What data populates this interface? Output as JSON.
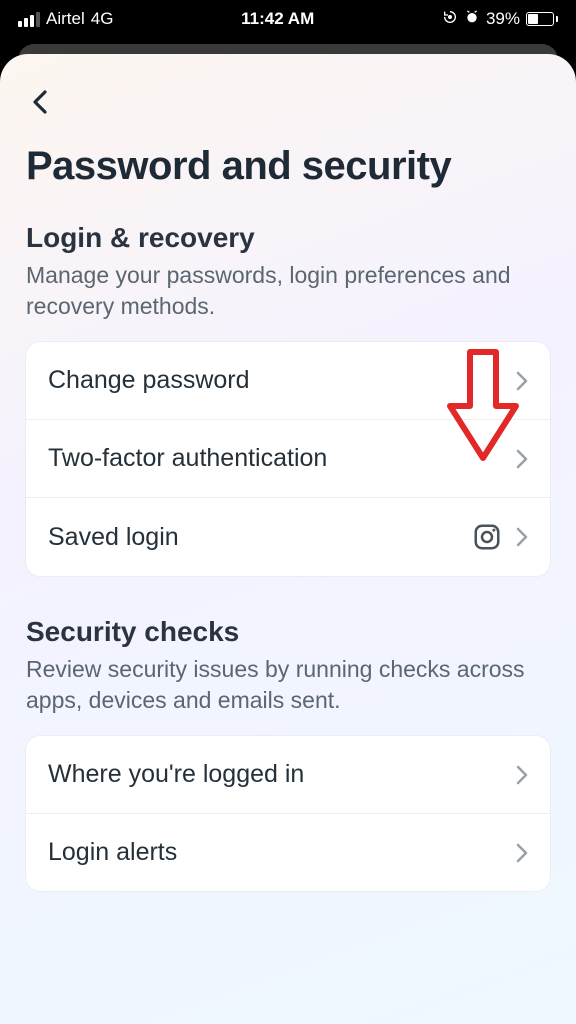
{
  "status": {
    "carrier": "Airtel",
    "network": "4G",
    "time": "11:42 AM",
    "battery_pct": "39%"
  },
  "page": {
    "title": "Password and security"
  },
  "sections": [
    {
      "title": "Login & recovery",
      "desc": "Manage your passwords, login preferences and recovery methods.",
      "items": [
        {
          "label": "Change password"
        },
        {
          "label": "Two-factor authentication"
        },
        {
          "label": "Saved login"
        }
      ]
    },
    {
      "title": "Security checks",
      "desc": "Review security issues by running checks across apps, devices and emails sent.",
      "items": [
        {
          "label": "Where you're logged in"
        },
        {
          "label": "Login alerts"
        }
      ]
    }
  ]
}
